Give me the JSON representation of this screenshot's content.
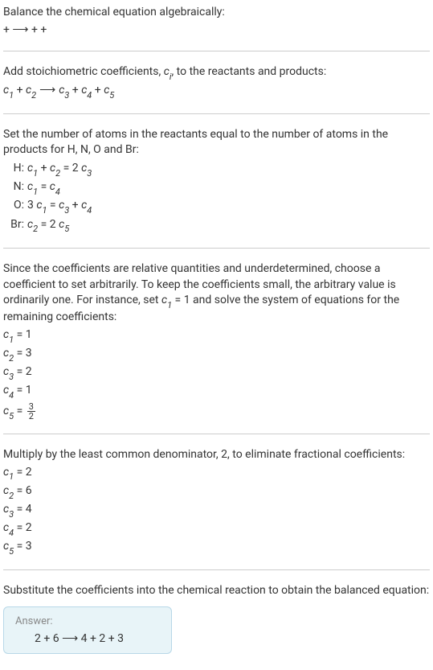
{
  "title": "Balance the chemical equation algebraically:",
  "reaction_skeleton": " +  ⟶  +  + ",
  "stoich_intro": "Add stoichiometric coefficients, ",
  "stoich_var": "c",
  "stoich_sub": "i",
  "stoich_intro_end": ", to the reactants and products:",
  "stoich_line": {
    "c1": "c",
    "s1": "1",
    "plus1": " + ",
    "c2": "c",
    "s2": "2",
    "arrow": " ⟶ ",
    "c3": "c",
    "s3": "3",
    "plus2": " + ",
    "c4": "c",
    "s4": "4",
    "plus3": " + ",
    "c5": "c",
    "s5": "5"
  },
  "atoms_intro": "Set the number of atoms in the reactants equal to the number of atoms in the products for H, N, O and Br:",
  "atoms": [
    {
      "label": "H:",
      "eq_prefix": "",
      "c1": "c",
      "s1": "1",
      "mid1": " + ",
      "c2": "c",
      "s2": "2",
      "mid2": " = 2 ",
      "c3": "c",
      "s3": "3",
      "suffix": ""
    },
    {
      "label": "N:",
      "eq_prefix": "",
      "c1": "c",
      "s1": "1",
      "mid1": " = ",
      "c2": "c",
      "s2": "4",
      "mid2": "",
      "c3": "",
      "s3": "",
      "suffix": ""
    },
    {
      "label": "O:",
      "eq_prefix": "3 ",
      "c1": "c",
      "s1": "1",
      "mid1": " = ",
      "c2": "c",
      "s2": "3",
      "mid2": " + ",
      "c3": "c",
      "s3": "4",
      "suffix": ""
    },
    {
      "label": "Br:",
      "eq_prefix": "",
      "c1": "c",
      "s1": "2",
      "mid1": " = 2 ",
      "c2": "c",
      "s2": "5",
      "mid2": "",
      "c3": "",
      "s3": "",
      "suffix": ""
    }
  ],
  "arbitrary_intro_1": "Since the coefficients are relative quantities and underdetermined, choose a coefficient to set arbitrarily. To keep the coefficients small, the arbitrary value is ordinarily one. For instance, set ",
  "arbitrary_c": "c",
  "arbitrary_s": "1",
  "arbitrary_intro_2": " = 1 and solve the system of equations for the remaining coefficients:",
  "solve1": [
    {
      "c": "c",
      "s": "1",
      "eq": " = 1"
    },
    {
      "c": "c",
      "s": "2",
      "eq": " = 3"
    },
    {
      "c": "c",
      "s": "3",
      "eq": " = 2"
    },
    {
      "c": "c",
      "s": "4",
      "eq": " = 1"
    }
  ],
  "solve1_frac": {
    "c": "c",
    "s": "5",
    "eq": " = ",
    "num": "3",
    "den": "2"
  },
  "lcd_text": "Multiply by the least common denominator, 2, to eliminate fractional coefficients:",
  "solve2": [
    {
      "c": "c",
      "s": "1",
      "eq": " = 2"
    },
    {
      "c": "c",
      "s": "2",
      "eq": " = 6"
    },
    {
      "c": "c",
      "s": "3",
      "eq": " = 4"
    },
    {
      "c": "c",
      "s": "4",
      "eq": " = 2"
    },
    {
      "c": "c",
      "s": "5",
      "eq": " = 3"
    }
  ],
  "sub_text": "Substitute the coefficients into the chemical reaction to obtain the balanced equation:",
  "answer_label": "Answer:",
  "answer_content": "2  + 6  ⟶ 4  + 2  + 3 "
}
